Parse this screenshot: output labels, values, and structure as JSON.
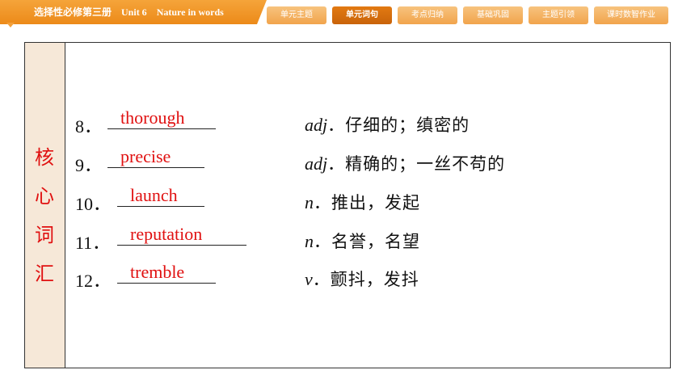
{
  "header": {
    "course": "选择性必修第三册",
    "unit": "Unit 6",
    "unit_title": "Nature in words"
  },
  "tabs": [
    {
      "label": "单元主题",
      "active": false
    },
    {
      "label": "单元词句",
      "active": true
    },
    {
      "label": "考点归纳",
      "active": false
    },
    {
      "label": "基础巩固",
      "active": false
    },
    {
      "label": "主题引领",
      "active": false
    },
    {
      "label": "课时数智作业",
      "active": false
    }
  ],
  "side_label": [
    "核",
    "心",
    "词",
    "汇"
  ],
  "vocab": [
    {
      "num": "8．",
      "answer": "thorough",
      "pos": "adj",
      "meaning": "．仔细的；缜密的"
    },
    {
      "num": "9．",
      "answer": "precise",
      "pos": "adj",
      "meaning": "．精确的；一丝不苟的"
    },
    {
      "num": "10．",
      "answer": "launch",
      "pos": "n",
      "meaning": "．推出，发起"
    },
    {
      "num": "11．",
      "answer": "reputation",
      "pos": "n",
      "meaning": "．名誉，名望"
    },
    {
      "num": "12．",
      "answer": "tremble",
      "pos": "v",
      "meaning": "．颤抖，发抖"
    }
  ],
  "colors": {
    "accent": "#ec8a19",
    "answer": "#e01010",
    "side_bg": "#f6e8d8"
  }
}
